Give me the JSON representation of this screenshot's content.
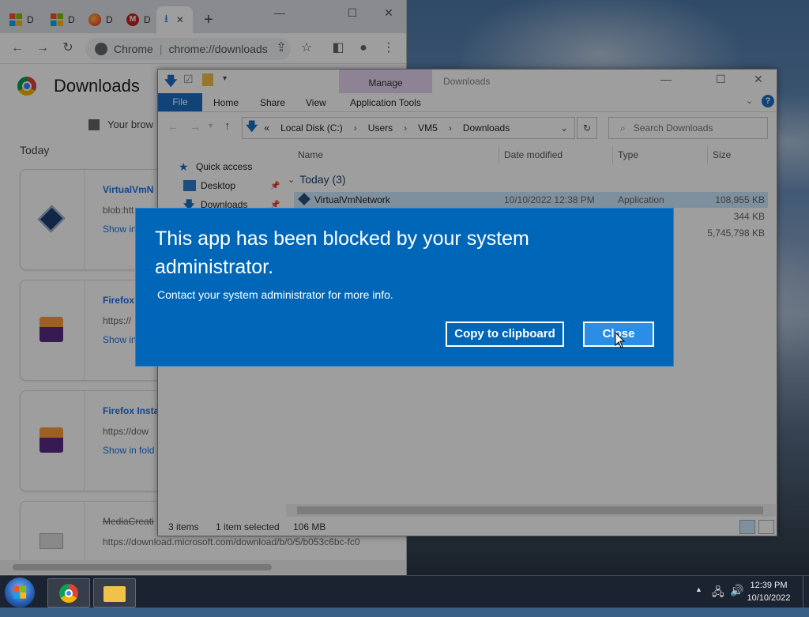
{
  "chrome": {
    "tabs": [
      {
        "label": "D",
        "icon": "windows-icon"
      },
      {
        "label": "D",
        "icon": "windows-icon"
      },
      {
        "label": "D",
        "icon": "firefox-icon"
      },
      {
        "label": "D",
        "icon": "gmail-icon"
      },
      {
        "label": "",
        "icon": "download-icon",
        "active": true
      }
    ],
    "new_tab": "+",
    "omnibox_site": "Chrome",
    "omnibox_url": "chrome://downloads",
    "page_title": "Downloads",
    "managed_text": "Your brow",
    "section": "Today",
    "downloads": [
      {
        "name": "VirtualVmN",
        "url": "blob:htt",
        "action": "Show in",
        "icon": "virtualbox-icon"
      },
      {
        "name": "Firefox",
        "url": "https://",
        "action": "Show in",
        "icon": "firefox-installer-icon"
      },
      {
        "name": "Firefox Insta",
        "url": "https://dow",
        "action": "Show in fold",
        "icon": "firefox-installer-icon"
      },
      {
        "name": "MediaCreati",
        "url": "https://download.microsoft.com/download/b/0/5/b053c6bc-fc0",
        "action": "",
        "icon": "document-icon",
        "removed": true
      }
    ]
  },
  "explorer": {
    "context_tab": "Manage",
    "window_title": "Downloads",
    "ribbon_tabs": [
      "File",
      "Home",
      "Share",
      "View",
      "Application Tools"
    ],
    "breadcrumb": [
      "Local Disk (C:)",
      "Users",
      "VM5",
      "Downloads"
    ],
    "breadcrumb_prefix": "«",
    "search_placeholder": "Search Downloads",
    "nav": [
      {
        "label": "Quick access",
        "icon": "star-icon"
      },
      {
        "label": "Desktop",
        "icon": "desktop-icon"
      },
      {
        "label": "Downloads",
        "icon": "download-arrow-icon"
      }
    ],
    "columns": [
      "Name",
      "Date modified",
      "Type",
      "Size"
    ],
    "group": "Today (3)",
    "files": [
      {
        "name": "VirtualVmNetwork",
        "date": "10/10/2022 12:38 PM",
        "type": "Application",
        "size": "108,955 KB"
      },
      {
        "name": "",
        "date": "",
        "type": "",
        "size": "344 KB"
      },
      {
        "name": "",
        "date": "",
        "type": "",
        "size": "5,745,798 KB"
      }
    ],
    "status_items": "3 items",
    "status_selected": "1 item selected",
    "status_size": "106 MB"
  },
  "dialog": {
    "title": "This app has been blocked by your system administrator.",
    "message": "Contact your system administrator for more info.",
    "copy_button": "Copy to clipboard",
    "close_button": "Close",
    "bg_color": "#0067b8"
  },
  "taskbar": {
    "time": "12:39 PM",
    "date": "10/10/2022"
  }
}
